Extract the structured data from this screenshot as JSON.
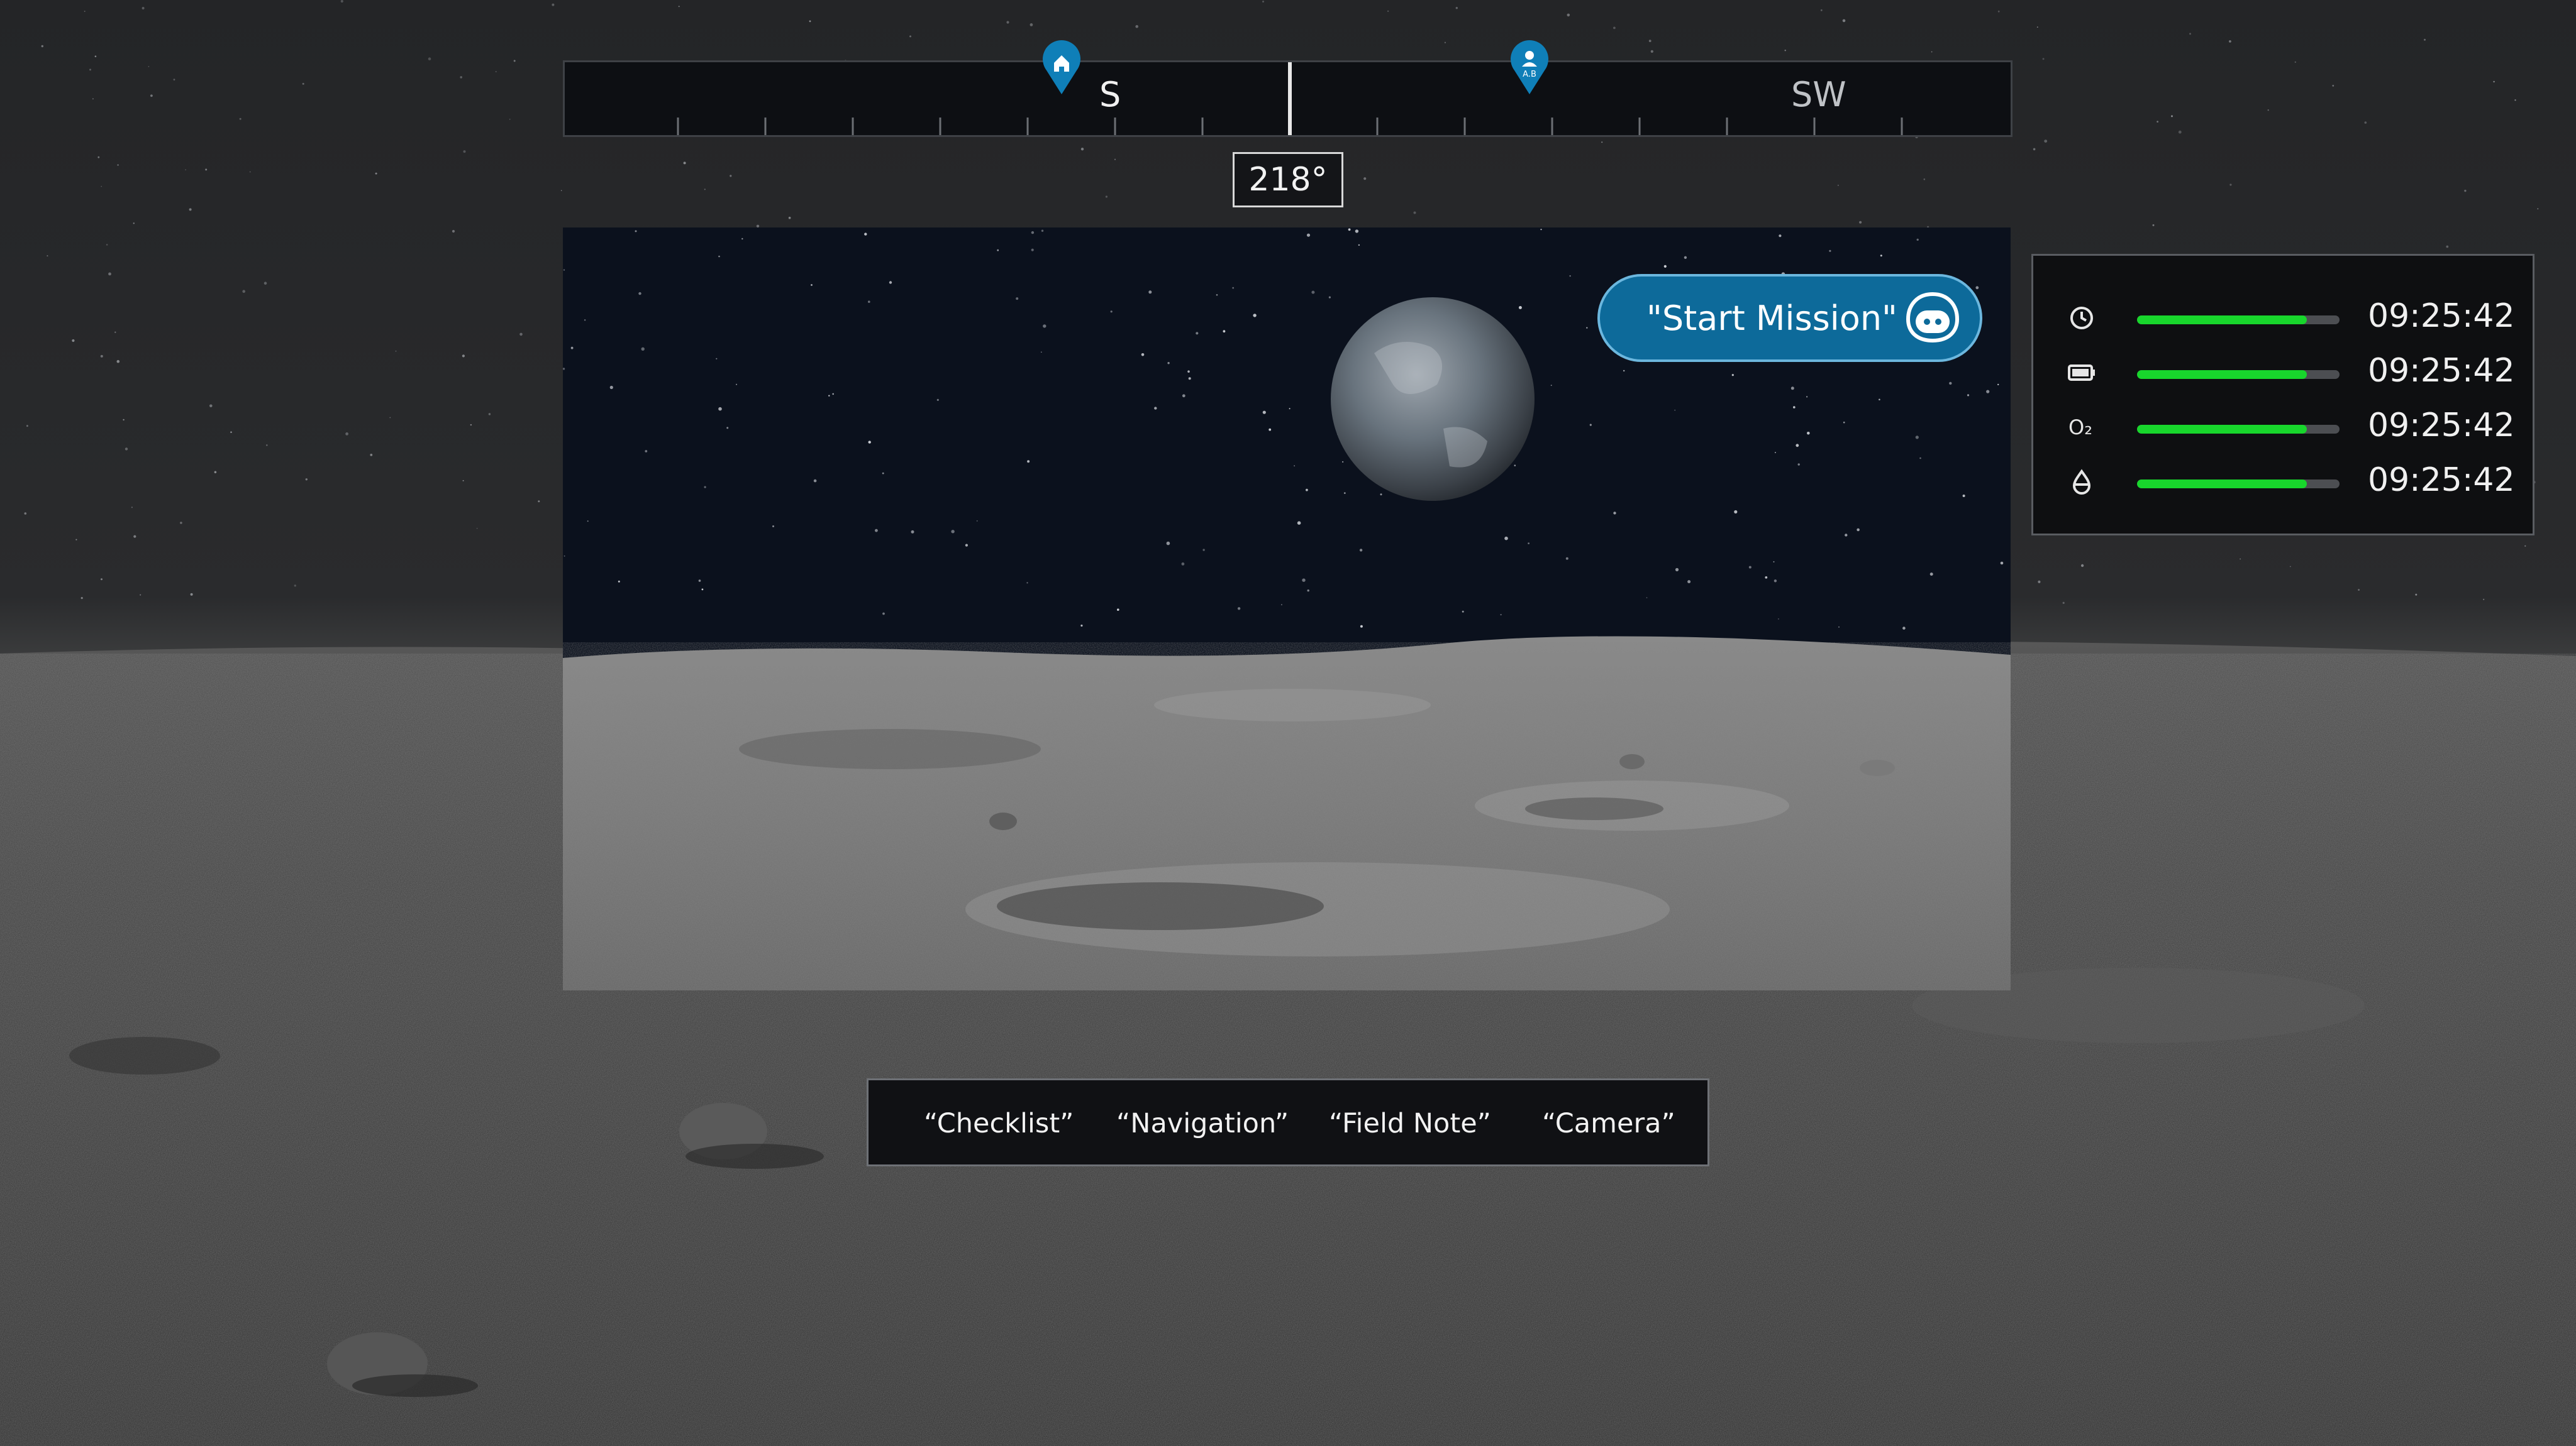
{
  "compass": {
    "cardinal_primary": "S",
    "cardinal_secondary": "SW",
    "heading": "218°",
    "markers": [
      {
        "icon": "home-icon",
        "label": ""
      },
      {
        "icon": "person-icon",
        "label": "A.B"
      }
    ]
  },
  "mission": {
    "start_label": "\"Start Mission\"",
    "assistant_icon": "astronaut-helmet-icon",
    "accent": "#0d6a9a"
  },
  "status": {
    "bar_color": "#18d62c",
    "rows": [
      {
        "icon": "clock-icon",
        "value": "09:25:42",
        "level": 0.84
      },
      {
        "icon": "battery-icon",
        "value": "09:25:42",
        "level": 0.84
      },
      {
        "icon": "oxygen-icon",
        "icon_text": "O₂",
        "value": "09:25:42",
        "level": 0.84
      },
      {
        "icon": "water-drop-icon",
        "value": "09:25:42",
        "level": 0.84
      }
    ]
  },
  "commands": {
    "checklist": "“Checklist”",
    "navigation": "“Navigation”",
    "field_note": "“Field Note”",
    "camera": "“Camera”"
  }
}
